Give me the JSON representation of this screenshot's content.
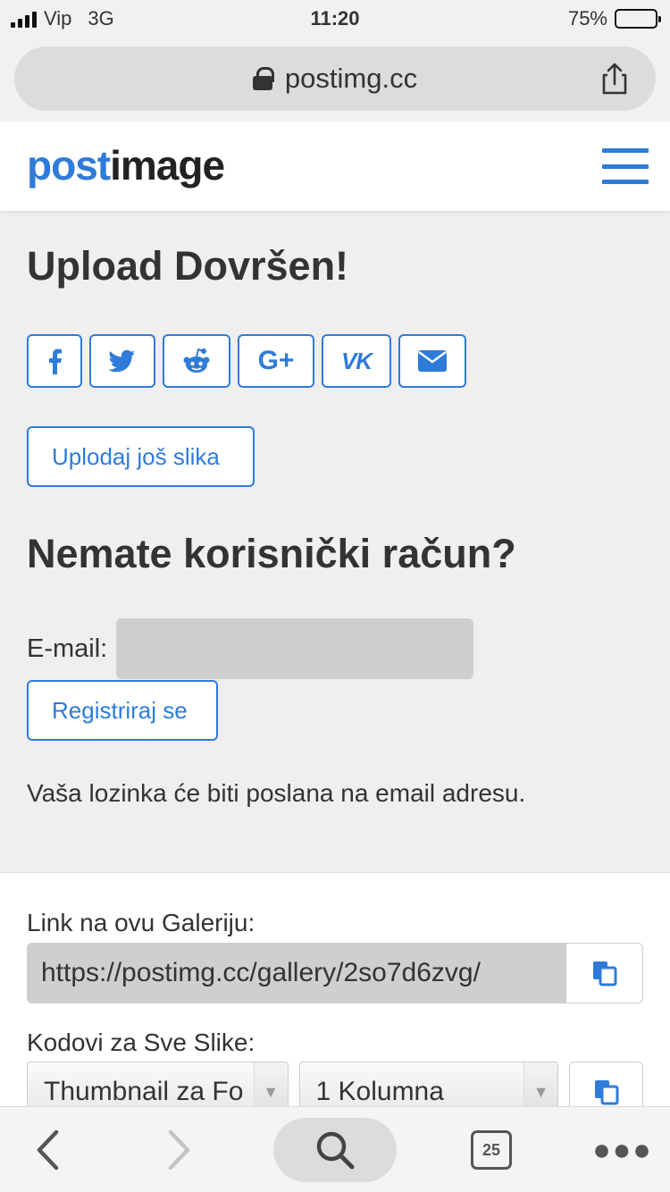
{
  "status_bar": {
    "carrier": "Vip",
    "network": "3G",
    "time": "11:20",
    "battery_pct": "75%",
    "battery_level": 0.75
  },
  "browser": {
    "url": "postimg.cc",
    "tabs_count": "25"
  },
  "site": {
    "logo_post": "post",
    "logo_image": "image"
  },
  "upload": {
    "title": "Upload Dovršen!",
    "share_buttons": [
      {
        "name": "facebook",
        "glyph": "f"
      },
      {
        "name": "twitter",
        "glyph": "twitter-bird"
      },
      {
        "name": "reddit",
        "glyph": "reddit-alien"
      },
      {
        "name": "google-plus",
        "glyph": "G+"
      },
      {
        "name": "vk",
        "glyph": "VK"
      },
      {
        "name": "email",
        "glyph": "envelope"
      }
    ],
    "upload_more_label": "Uplodaj još slika"
  },
  "account": {
    "title": "Nemate korisnički račun?",
    "email_label": "E-mail:",
    "email_value": "",
    "register_label": "Registriraj se",
    "password_note": "Vaša lozinka će biti poslana na email adresu."
  },
  "gallery": {
    "link_label": "Link na ovu Galeriju:",
    "link_value": "https://postimg.cc/gallery/2so7d6zvg/",
    "codes_label": "Kodovi za Sve Slike:",
    "code_type_selected": "Thumbnail za Fo",
    "columns_selected": "1 Kolumna"
  },
  "colors": {
    "accent": "#2f7bd9",
    "background": "#efeff0",
    "field_gray": "#cfcfd0"
  }
}
